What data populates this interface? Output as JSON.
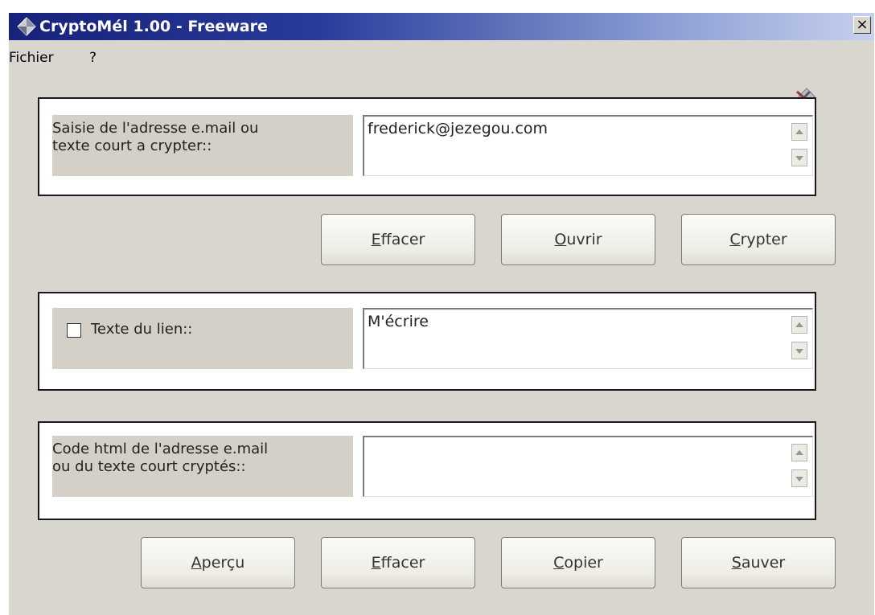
{
  "window": {
    "title": "CryptoMél 1.00 - Freeware",
    "close_label": "×",
    "icon": "app-diamond-icon"
  },
  "menu": [
    {
      "label": "Fichier"
    },
    {
      "label": "?"
    }
  ],
  "section_input": {
    "label_line1": "Saisie de l'adresse e.mail  ou",
    "label_line2": "texte court a crypter::",
    "value": "frederick@jezegou.com"
  },
  "buttons_top": [
    {
      "mnemonic": "E",
      "rest": "ffacer"
    },
    {
      "mnemonic": "O",
      "rest": "uvrir"
    },
    {
      "mnemonic": "C",
      "rest": "rypter"
    }
  ],
  "section_link": {
    "checkbox_label": "Texte du lien::",
    "checked": false,
    "value": "M'écrire"
  },
  "section_output": {
    "label_line1": "Code html de l'adresse e.mail",
    "label_line2": "ou du texte court  cryptés::",
    "value": ""
  },
  "buttons_bottom": [
    {
      "mnemonic": "A",
      "rest": "perçu"
    },
    {
      "mnemonic": "E",
      "rest": "ffacer"
    },
    {
      "mnemonic": "C",
      "rest": "opier"
    },
    {
      "mnemonic": "S",
      "rest": "auver"
    }
  ],
  "colors": {
    "titlebar_start": "#17227a",
    "titlebar_end": "#c7d1ee",
    "window_bg": "#d9d6d0",
    "label_bg": "#d4d0c8"
  }
}
